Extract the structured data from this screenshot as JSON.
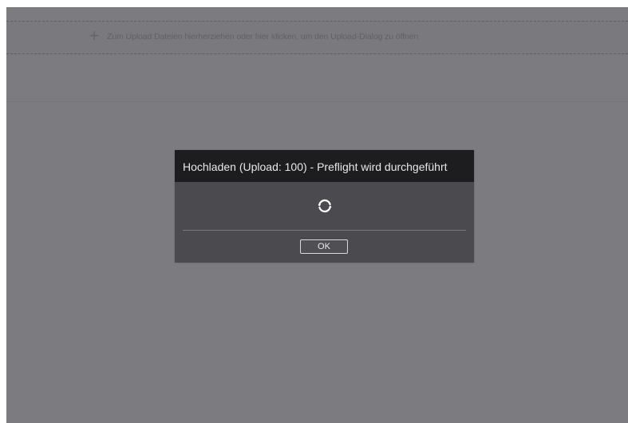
{
  "dropzone": {
    "icon": "plus-icon",
    "icon_glyph": "+",
    "text": "Zum Upload Dateien hierherziehen oder hier klicken, um den Upload-Dialog zu öffnen"
  },
  "dialog": {
    "title": "Hochladen (Upload: 100) - Preflight wird durchgeführt",
    "spinner_icon": "refresh-icon",
    "ok_label": "OK"
  },
  "colors": {
    "overlay": "#7c7c80",
    "dialog_body": "#4a4a4f",
    "dialog_header": "#1d1d20",
    "text_light": "#e8e8ea"
  }
}
